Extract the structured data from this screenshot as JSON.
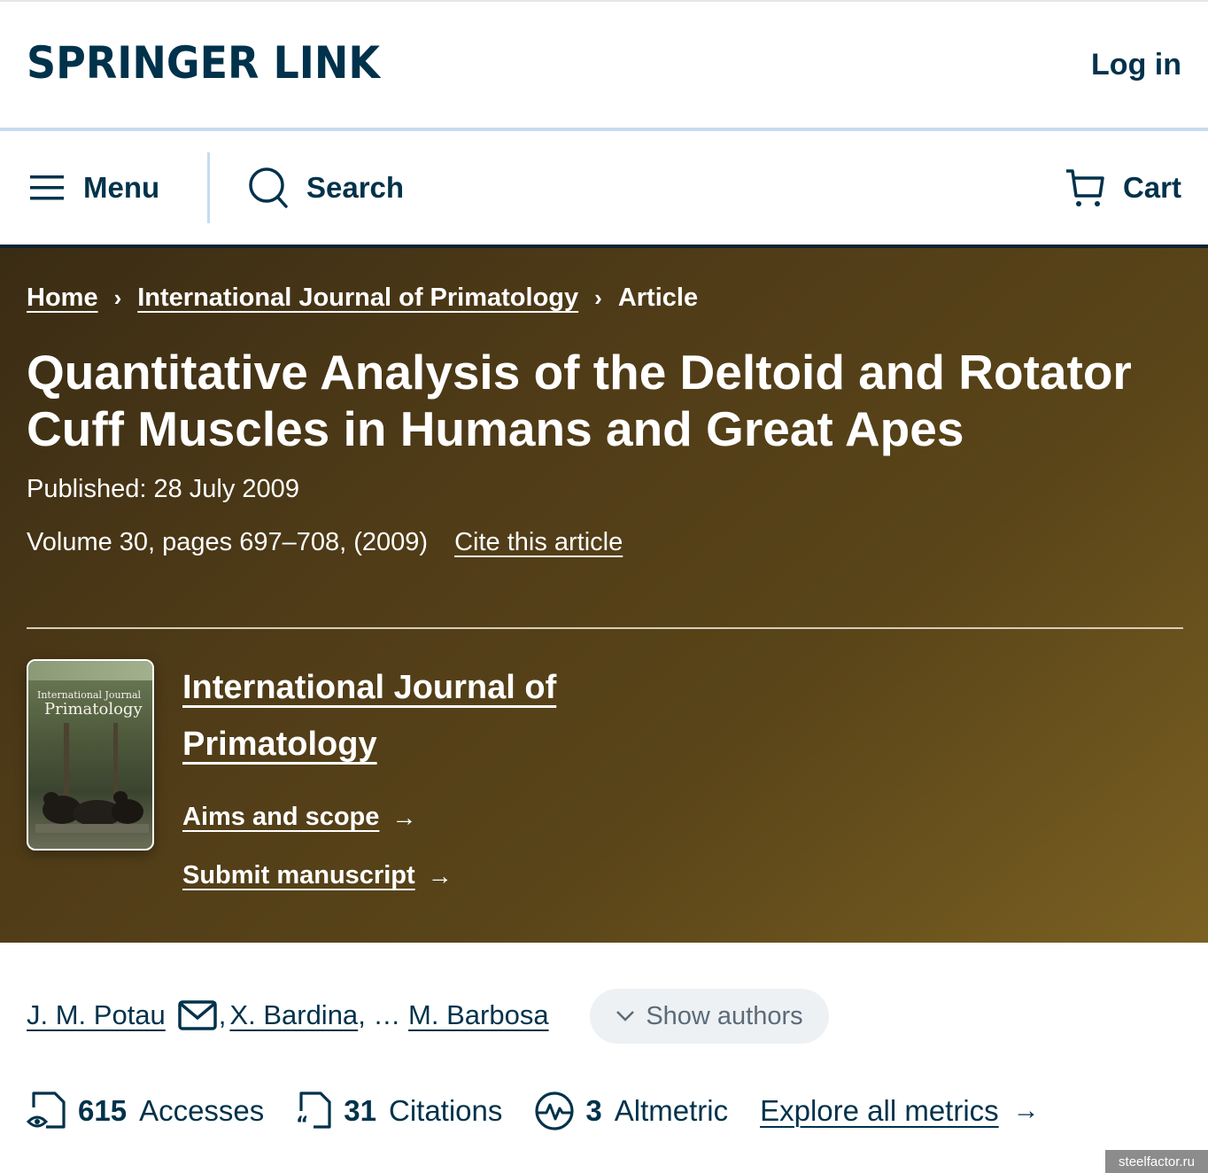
{
  "header": {
    "logo": "SPRINGER LINK",
    "login": "Log in"
  },
  "nav": {
    "menu": "Menu",
    "search": "Search",
    "cart": "Cart"
  },
  "breadcrumb": {
    "home": "Home",
    "journal": "International Journal of Primatology",
    "current": "Article"
  },
  "article": {
    "title": "Quantitative Analysis of the Deltoid and Rotator Cuff Muscles in Humans and Great Apes",
    "published": "Published: 28 July 2009",
    "volume": "Volume 30, pages 697–708, (2009)",
    "cite": "Cite this article"
  },
  "journal": {
    "cover_line1": "International Journal",
    "cover_line2": "Primatology",
    "title_line1": "International Journal of",
    "title_line2": "Primatology",
    "aims": "Aims and scope",
    "submit": "Submit manuscript"
  },
  "authors": {
    "first": "J. M. Potau",
    "second": "X. Bardina",
    "ellipsis": "…",
    "last": "M. Barbosa",
    "show": "Show authors"
  },
  "metrics": {
    "accesses_num": "615",
    "accesses_label": "Accesses",
    "citations_num": "31",
    "citations_label": "Citations",
    "altmetric_num": "3",
    "altmetric_label": "Altmetric",
    "explore": "Explore all metrics"
  },
  "watermark": "steelfactor.ru",
  "colors": {
    "brand": "#01324b",
    "hero_start": "#3a2c14",
    "hero_end": "#7a6022",
    "separator": "#c7dbef"
  }
}
